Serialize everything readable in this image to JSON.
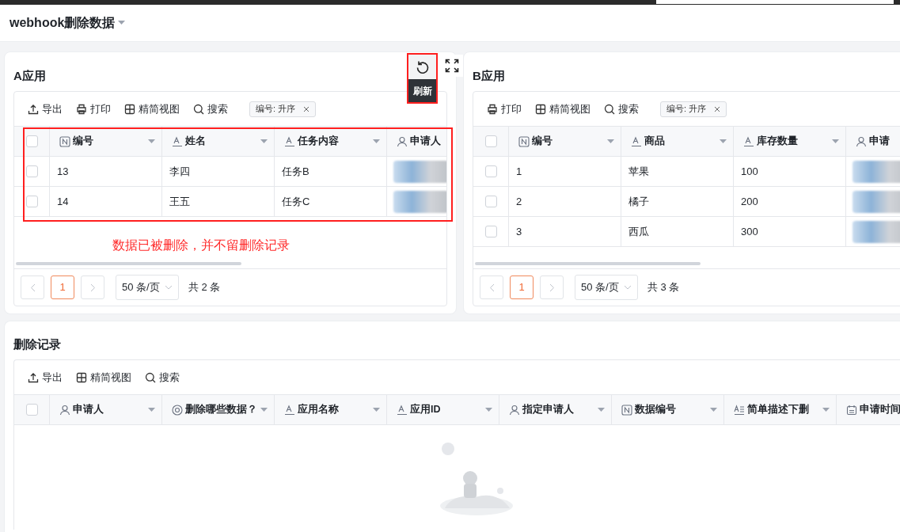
{
  "app_title": "webhook删除数据",
  "panels": [
    {
      "title": "A应用",
      "select_all_checked": false,
      "toolbar": [
        {
          "kind": "export",
          "label": "导出"
        },
        {
          "kind": "print",
          "label": "打印"
        },
        {
          "kind": "grid",
          "label": "精简视图"
        },
        {
          "kind": "search",
          "label": "搜索"
        }
      ],
      "sort_tag": "编号: 升序",
      "columns": [
        {
          "kind": "number",
          "label": "编号"
        },
        {
          "kind": "text",
          "label": "姓名"
        },
        {
          "kind": "text",
          "label": "任务内容"
        },
        {
          "kind": "person",
          "label": "申请人"
        }
      ],
      "rows": [
        {
          "checked": false,
          "cells": [
            "13",
            "李四",
            "任务B"
          ]
        },
        {
          "checked": false,
          "cells": [
            "14",
            "王五",
            "任务C"
          ]
        }
      ],
      "pagination": {
        "page": "1",
        "page_size": "50 条/页",
        "total": "共 2 条"
      },
      "refresh_tooltip": "刷新",
      "annotation": "数据已被删除，并不留删除记录"
    },
    {
      "title": "B应用",
      "select_all_checked": false,
      "toolbar": [
        {
          "kind": "print",
          "label": "打印"
        },
        {
          "kind": "grid",
          "label": "精简视图"
        },
        {
          "kind": "search",
          "label": "搜索"
        }
      ],
      "sort_tag": "编号: 升序",
      "columns": [
        {
          "kind": "number",
          "label": "编号"
        },
        {
          "kind": "text",
          "label": "商品"
        },
        {
          "kind": "text",
          "label": "库存数量"
        },
        {
          "kind": "person",
          "label": "申请"
        }
      ],
      "rows": [
        {
          "checked": false,
          "cells": [
            "1",
            "苹果",
            "100"
          ]
        },
        {
          "checked": false,
          "cells": [
            "2",
            "橘子",
            "200"
          ]
        },
        {
          "checked": false,
          "cells": [
            "3",
            "西瓜",
            "300"
          ]
        }
      ],
      "pagination": {
        "page": "1",
        "page_size": "50 条/页",
        "total": "共 3 条"
      }
    }
  ],
  "deletion_log": {
    "title": "删除记录",
    "select_all_checked": false,
    "toolbar": [
      {
        "kind": "export",
        "label": "导出"
      },
      {
        "kind": "grid",
        "label": "精简视图"
      },
      {
        "kind": "search",
        "label": "搜索"
      }
    ],
    "columns": [
      {
        "kind": "person",
        "label": "申请人"
      },
      {
        "kind": "select",
        "label": "删除哪些数据？"
      },
      {
        "kind": "text",
        "label": "应用名称"
      },
      {
        "kind": "text",
        "label": "应用ID"
      },
      {
        "kind": "person",
        "label": "指定申请人"
      },
      {
        "kind": "number",
        "label": "数据编号"
      },
      {
        "kind": "longtext",
        "label": "简单描述下删"
      },
      {
        "kind": "date",
        "label": "申请时间"
      }
    ]
  }
}
